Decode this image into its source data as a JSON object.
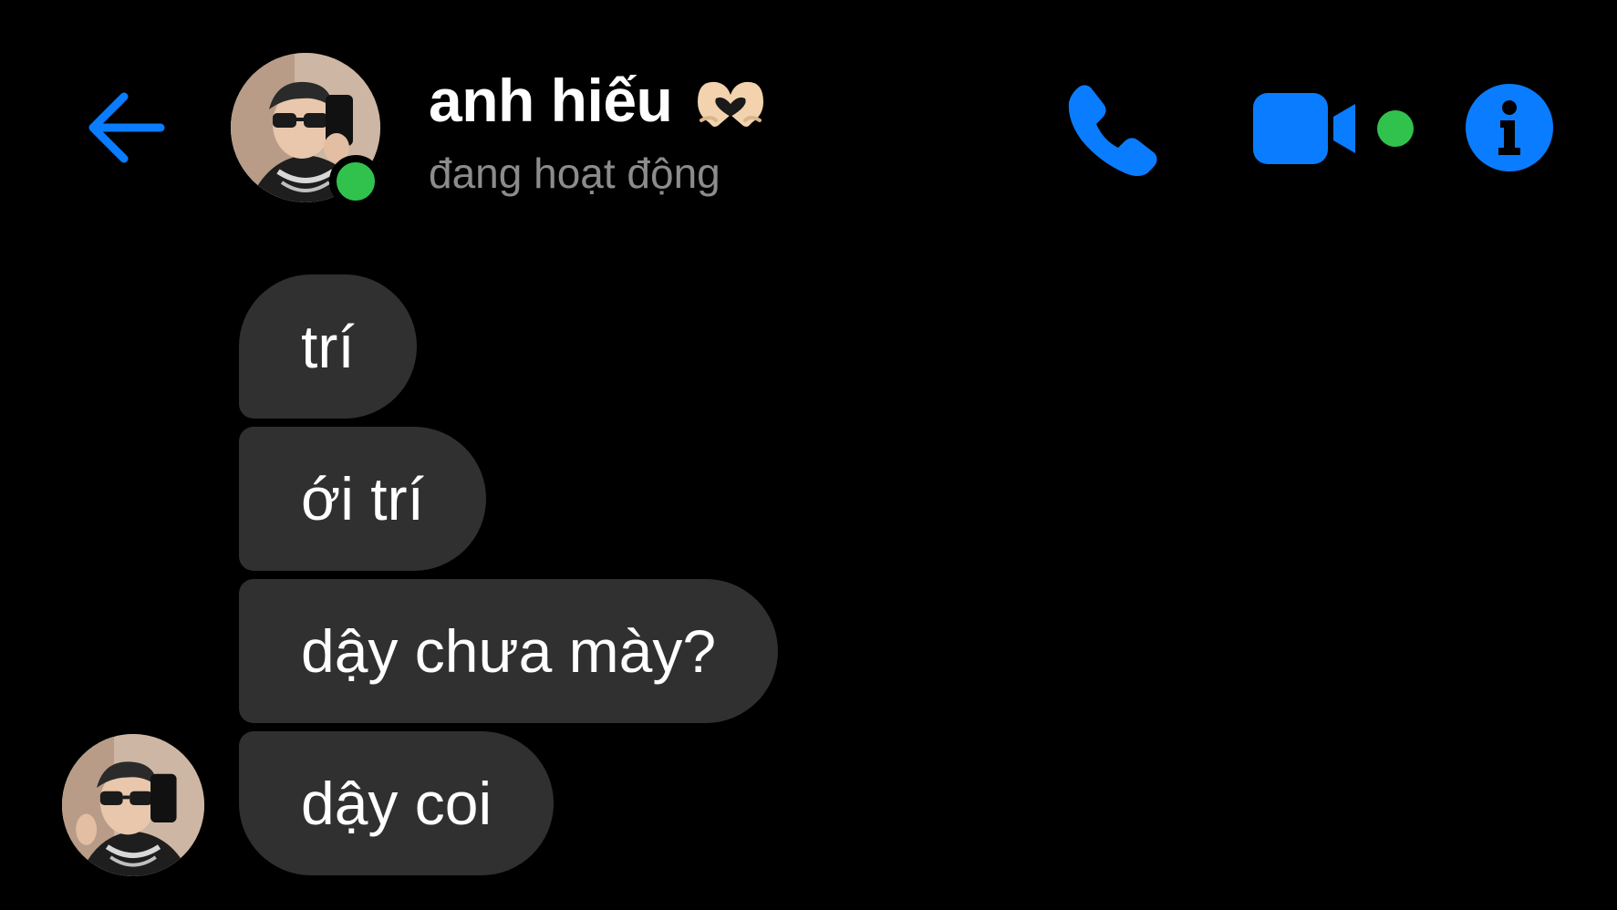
{
  "header": {
    "contact_name": "anh hiếu",
    "status": "đang hoạt động",
    "back_icon": "arrow-left-icon",
    "name_emoji": "heart-hands-icon",
    "actions": [
      {
        "name": "call",
        "icon": "phone-icon"
      },
      {
        "name": "video",
        "icon": "video-camera-icon"
      },
      {
        "name": "info",
        "icon": "info-icon"
      }
    ]
  },
  "messages": [
    {
      "text": "trí"
    },
    {
      "text": "ới trí"
    },
    {
      "text": "dậy chưa mày?"
    },
    {
      "text": "dậy coi"
    }
  ],
  "colors": {
    "background": "#000000",
    "accent": "#0a7cff",
    "bubble": "#303030",
    "online": "#31c24d",
    "status_text": "#8c8c8c"
  }
}
